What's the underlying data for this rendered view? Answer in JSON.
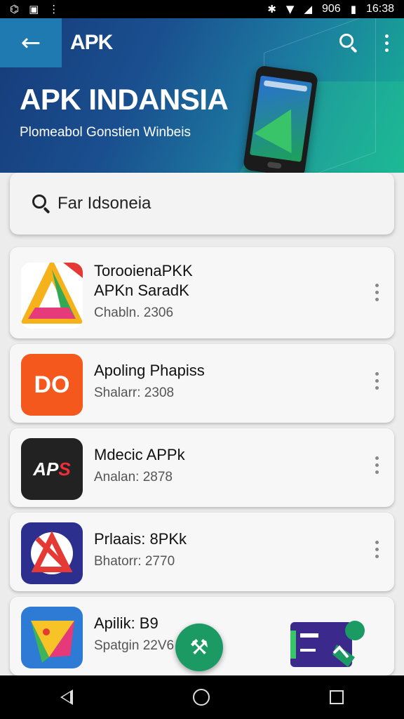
{
  "status_bar": {
    "network_label": "906",
    "time": "16:38",
    "icons": [
      "camera-icon",
      "image-icon",
      "bluetooth-icon",
      "wifi-icon",
      "signal-icon",
      "battery-icon"
    ]
  },
  "header": {
    "app_title": "APK",
    "back_icon": "arrow-left-icon",
    "actions": [
      "search-icon",
      "more-vert-icon"
    ]
  },
  "hero": {
    "title": "APK INDANSIA",
    "subtitle": "Plomeabol Gonstien Winbeis"
  },
  "search": {
    "query": "Far Idsoneia"
  },
  "apps": [
    {
      "name_line1": "TorooienaPKK",
      "name_line2": "APKn SaradK",
      "meta": "Chabln. 2306",
      "icon": "triangle-logo-icon"
    },
    {
      "name_line1": "Apoling Phapiss",
      "name_line2": "",
      "meta": "Shalarr: 2308",
      "icon": "orange-logo-icon",
      "icon_text": "DO"
    },
    {
      "name_line1": "Mdecic APPk",
      "name_line2": "",
      "meta": "Analan: 2878",
      "icon": "aps-logo-icon",
      "icon_text_a": "AP",
      "icon_text_b": "S"
    },
    {
      "name_line1": "Prlaais: 8PKk",
      "name_line2": "",
      "meta": "Bhatorr: 2770",
      "icon": "a-logo-icon"
    },
    {
      "name_line1": "Apilik: B9",
      "name_line2": "",
      "meta": "Spatgin 22V6",
      "icon": "play-logo-icon"
    }
  ],
  "colors": {
    "hero_start": "#163b7a",
    "hero_end": "#16b394",
    "fab": "#1b9a63",
    "back_button": "#1e7ab0"
  },
  "fab": {
    "icon": "hammer-icon"
  },
  "promo": {
    "icon": "promo-banner-icon"
  },
  "nav": [
    "back-nav-icon",
    "home-nav-icon",
    "recents-nav-icon"
  ]
}
